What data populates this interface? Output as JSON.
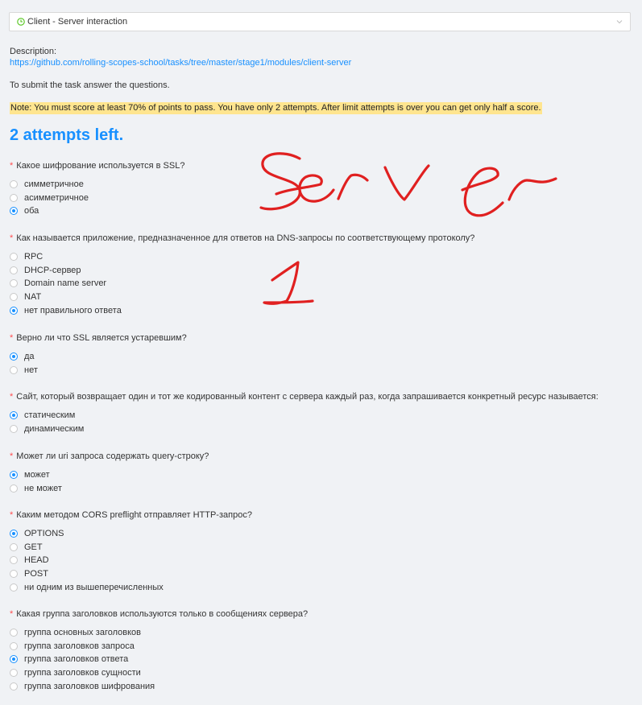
{
  "task_select": {
    "value": "Client - Server interaction"
  },
  "description": {
    "label": "Description:",
    "link": "https://github.com/rolling-scopes-school/tasks/tree/master/stage1/modules/client-server"
  },
  "submit_text": "To submit the task answer the questions.",
  "note": "Note: You must score at least 70% of points to pass. You have only 2 attempts. After limit attempts is over you can get only half a score.",
  "attempts_left": "2 attempts left.",
  "questions": [
    {
      "required_mark": "*",
      "title": "Какое шифрование используется в SSL?",
      "options": [
        "симметричное",
        "асимметричное",
        "оба"
      ],
      "selected": 2
    },
    {
      "required_mark": "*",
      "title": "Как называется приложение, предназначенное для ответов на DNS-запросы по соответствующему протоколу?",
      "options": [
        "RPC",
        "DHCP-сервер",
        "Domain name server",
        "NAT",
        "нет правильного ответа"
      ],
      "selected": 4
    },
    {
      "required_mark": "*",
      "title": "Верно ли что SSL является устаревшим?",
      "options": [
        "да",
        "нет"
      ],
      "selected": 0
    },
    {
      "required_mark": "*",
      "title": "Сайт, который возвращает один и тот же кодированный контент с сервера каждый раз, когда запрашивается конкретный ресурс называется:",
      "options": [
        "статическим",
        "динамическим"
      ],
      "selected": 0
    },
    {
      "required_mark": "*",
      "title": "Может ли uri запроса содержать query-строку?",
      "options": [
        "может",
        "не может"
      ],
      "selected": 0
    },
    {
      "required_mark": "*",
      "title": "Каким методом CORS preflight отправляет HTTP-запрос?",
      "options": [
        "OPTIONS",
        "GET",
        "HEAD",
        "POST",
        "ни одним из вышеперечисленных"
      ],
      "selected": 0
    },
    {
      "required_mark": "*",
      "title": "Какая группа заголовков используются только в сообщениях сервера?",
      "options": [
        "группа основных заголовков",
        "группа заголовков запроса",
        "группа заголовков ответа",
        "группа заголовков сущности",
        "группа заголовков шифрования"
      ],
      "selected": 2
    }
  ],
  "handwriting": {
    "word": "Server",
    "number": "1",
    "color": "#e02020"
  },
  "icons": {
    "select": "clock-icon",
    "dropdown": "chevron-down-icon"
  },
  "colors": {
    "accent": "#1890ff",
    "required": "#ff4d4f",
    "note_bg": "#ffe58f"
  }
}
